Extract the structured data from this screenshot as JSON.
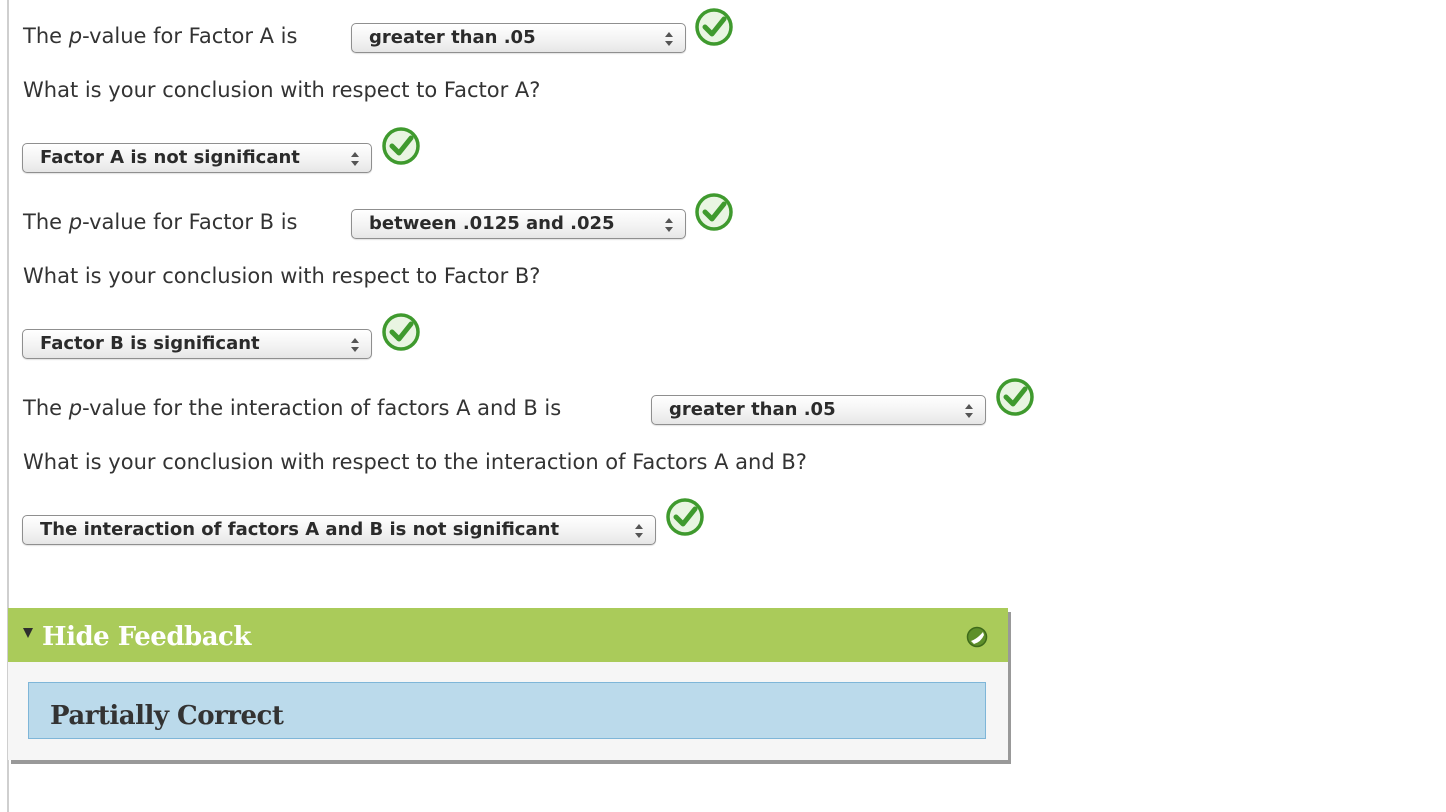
{
  "questions": [
    {
      "prefix": "The ",
      "italic": "p",
      "suffix": "-value for Factor A is",
      "selected": "greater than .05",
      "correct": true
    },
    {
      "prompt": "What is your conclusion with respect to Factor A?",
      "selected": "Factor A is not significant",
      "correct": true
    },
    {
      "prefix": "The ",
      "italic": "p",
      "suffix": "-value for Factor B is",
      "selected": "between .0125 and .025",
      "correct": true
    },
    {
      "prompt": "What is your conclusion with respect to Factor B?",
      "selected": "Factor B is significant",
      "correct": true
    },
    {
      "prefix": "The ",
      "italic": "p",
      "suffix": "-value for the interaction of factors A and B is",
      "selected": "greater than .05",
      "correct": true
    },
    {
      "prompt": "What is your conclusion with respect to the interaction of Factors A and B?",
      "selected": "The interaction of factors A and B is not significant",
      "correct": true
    }
  ],
  "feedback": {
    "toggle_label": "Hide Feedback",
    "status": "Partially Correct",
    "header_color": "#aacb5a",
    "box_color": "#bbdaeb"
  },
  "colors": {
    "correct_check": "#3f9a2e"
  }
}
